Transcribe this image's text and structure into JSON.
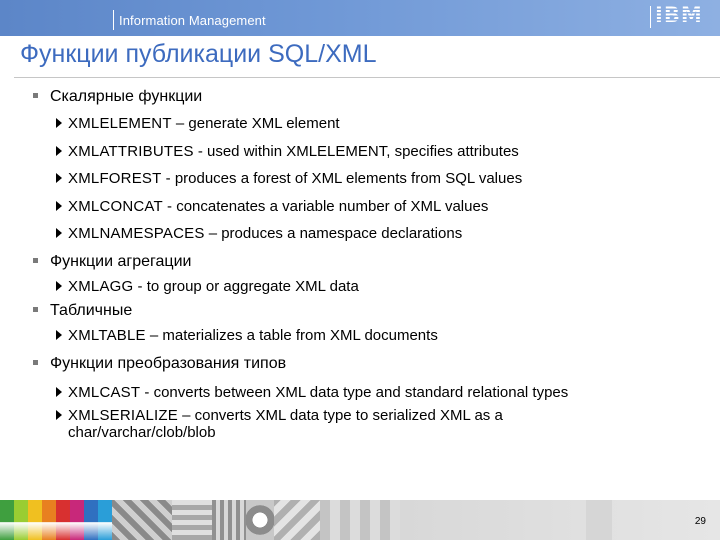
{
  "header": {
    "section_label": "Information Management",
    "logo_text": "IBM"
  },
  "slide": {
    "title": "Функции публикации SQL/XML",
    "bullets": [
      {
        "label": "Скалярные функции",
        "items": [
          {
            "keyword": "XMLELEMENT",
            "rest": " – generate XML element"
          },
          {
            "keyword": "XMLATTRIBUTES",
            "rest": " - used within XMLELEMENT, specifies attributes"
          },
          {
            "keyword": "XMLFOREST",
            "rest": " - produces a forest of XML elements from SQL values"
          },
          {
            "keyword": "XMLCONCAT",
            "rest": " - concatenates a variable number of XML values"
          },
          {
            "keyword": "XMLNAMESPACES",
            "rest": " – produces a namespace declarations"
          }
        ]
      },
      {
        "label": "Функции агрегации",
        "items": [
          {
            "keyword": "XMLAGG",
            "rest": " - to group or aggregate XML data"
          }
        ]
      },
      {
        "label": "Табличные",
        "items": [
          {
            "keyword": "XMLTABLE",
            "rest": " – materializes a table from XML documents"
          }
        ]
      },
      {
        "label": "Функции преобразования типов",
        "items": [
          {
            "keyword": "XMLCAST",
            "rest": " - converts between XML data type and standard relational types"
          },
          {
            "keyword": "XMLSERIALIZE",
            "rest": " – converts XML data type to serialized XML as a",
            "continuation": "char/varchar/clob/blob"
          }
        ]
      }
    ]
  },
  "footer": {
    "page_number": "29",
    "tile_colors": [
      "#3f9f3f",
      "#9acd32",
      "#f0c020",
      "#e88020",
      "#d83030",
      "#c8287a",
      "#3070c0",
      "#2a9ed8"
    ]
  }
}
